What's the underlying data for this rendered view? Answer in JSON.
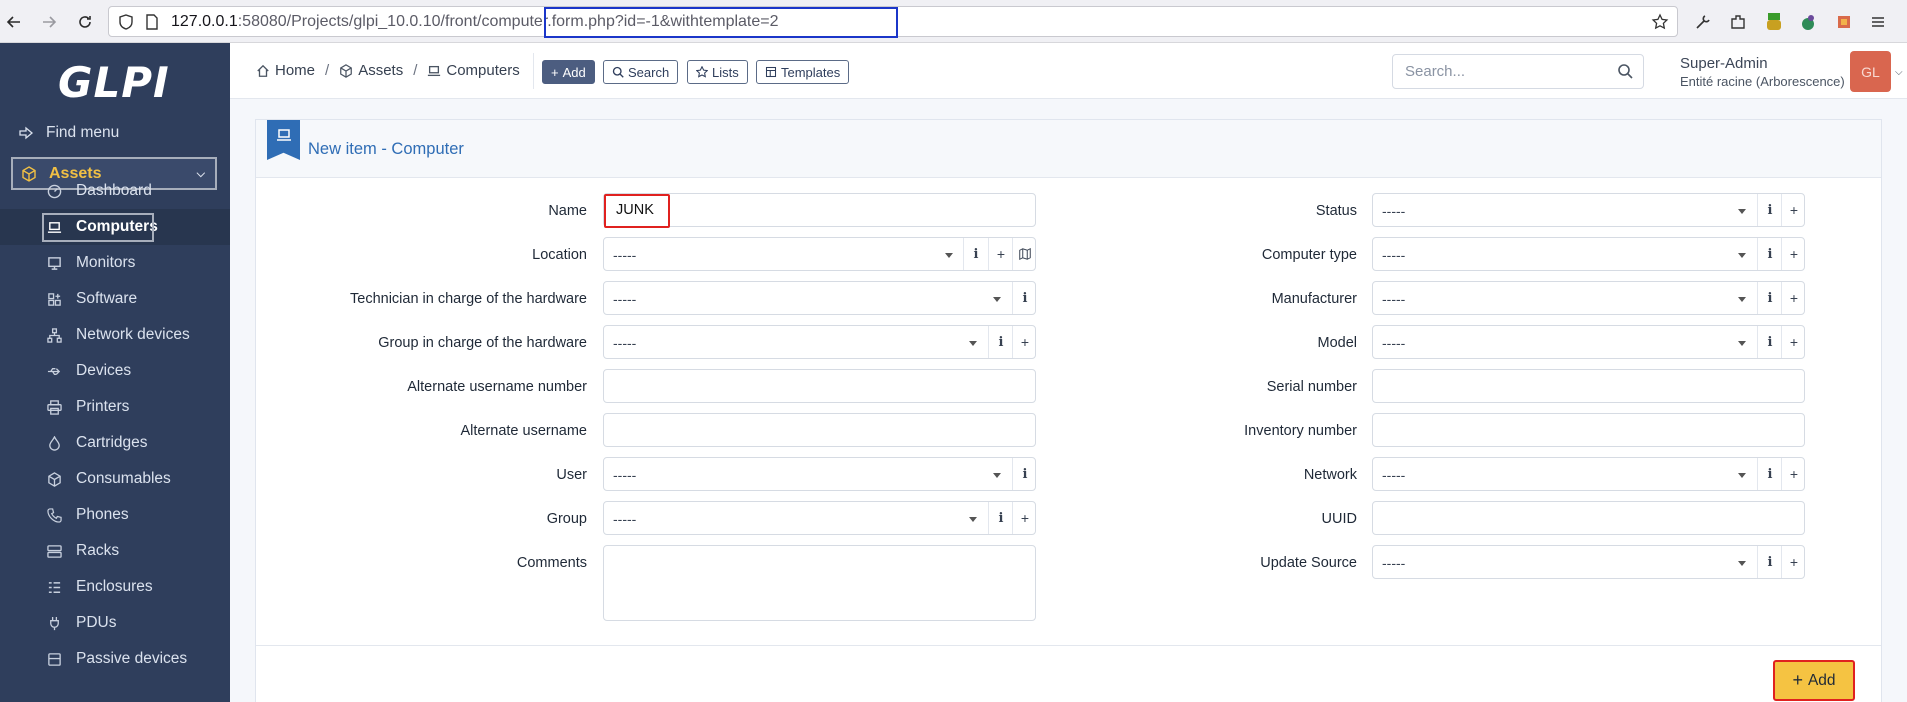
{
  "browser": {
    "url_host": "127.0.0.1",
    "url_rest": ":58080/Projects/glpi_10.0.10",
    "url_path": "/front/computer.form.php?id=-1&withtemplate=2"
  },
  "sidebar": {
    "logo": "GLPI",
    "find_menu": "Find menu",
    "section": "Assets",
    "items": [
      {
        "label": "Dashboard",
        "icon": "dashboard-icon"
      },
      {
        "label": "Computers",
        "icon": "laptop-icon"
      },
      {
        "label": "Monitors",
        "icon": "monitor-icon"
      },
      {
        "label": "Software",
        "icon": "apps-icon"
      },
      {
        "label": "Network devices",
        "icon": "network-icon"
      },
      {
        "label": "Devices",
        "icon": "usb-icon"
      },
      {
        "label": "Printers",
        "icon": "printer-icon"
      },
      {
        "label": "Cartridges",
        "icon": "droplet-icon"
      },
      {
        "label": "Consumables",
        "icon": "package-icon"
      },
      {
        "label": "Phones",
        "icon": "phone-icon"
      },
      {
        "label": "Racks",
        "icon": "server-icon"
      },
      {
        "label": "Enclosures",
        "icon": "columns-icon"
      },
      {
        "label": "PDUs",
        "icon": "plug-icon"
      },
      {
        "label": "Passive devices",
        "icon": "box-icon"
      }
    ]
  },
  "header": {
    "breadcrumb": [
      "Home",
      "Assets",
      "Computers"
    ],
    "buttons": {
      "add": "Add",
      "search": "Search",
      "lists": "Lists",
      "templates": "Templates"
    },
    "search_placeholder": "Search...",
    "user_name": "Super-Admin",
    "user_entity": "Entité racine (Arborescence)",
    "avatar_initials": "GL"
  },
  "form": {
    "title": "New item - Computer",
    "left": {
      "name_label": "Name",
      "name_value": "JUNK",
      "location_label": "Location",
      "tech_label": "Technician in charge of the hardware",
      "group_hw_label": "Group in charge of the hardware",
      "alt_num_label": "Alternate username number",
      "alt_user_label": "Alternate username",
      "user_label": "User",
      "group_label": "Group",
      "comments_label": "Comments"
    },
    "right": {
      "status_label": "Status",
      "type_label": "Computer type",
      "manufacturer_label": "Manufacturer",
      "model_label": "Model",
      "serial_label": "Serial number",
      "inventory_label": "Inventory number",
      "network_label": "Network",
      "uuid_label": "UUID",
      "update_source_label": "Update Source"
    },
    "empty_select": "-----",
    "info_glyph": "i",
    "plus_glyph": "+",
    "submit_label": "Add"
  },
  "colors": {
    "sidebar_bg": "#2f3e5c",
    "accent": "#2f6db5",
    "active_section": "#f1c044",
    "submit_bg": "#f5c342",
    "highlight_red": "#e0211f",
    "highlight_blue": "#1b36c9"
  }
}
